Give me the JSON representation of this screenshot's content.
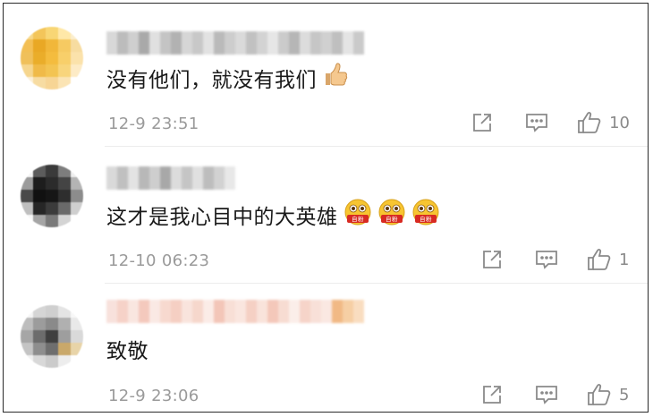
{
  "colors": {
    "text": "#1a1a1a",
    "meta": "#9a9a9a",
    "icon": "#8a8a8a",
    "divider": "#ececec",
    "border": "#2a2a2a"
  },
  "comments": [
    {
      "text": "没有他们，就没有我们",
      "emoji_icons": [
        "thumbs-up-icon"
      ],
      "time": "12-9 23:51",
      "like_count": "10",
      "avatar_colors": [
        "#f7d88a",
        "#f3c55a",
        "#f8d675",
        "#ffe8a8",
        "#fbeecd",
        "#f3bf54",
        "#e9a825",
        "#f1b73a",
        "#f6ca62",
        "#f7dca0",
        "#f0c05a",
        "#eaad2a",
        "#f4bc3e",
        "#f8cf6a",
        "#fbe2ab",
        "#f6d68e",
        "#f0ba48",
        "#f3c452",
        "#f8d57c",
        "#fdebc6",
        "#fcefd6",
        "#f7dca2",
        "#f7d595",
        "#fbe4b4",
        "#ffffff"
      ],
      "name_colors": [
        "#d8d8d8",
        "#bcbcbc",
        "#cfcfcf",
        "#a9a9a9",
        "#e0e0e0",
        "#c4c4c4",
        "#b2b2b2",
        "#d6d6d6",
        "#c8c8c8",
        "#e2e2e2",
        "#bababa",
        "#cdcdcd",
        "#dadada",
        "#c1c1c1",
        "#d3d3d3",
        "#e6e6e6",
        "#cbcbcb",
        "#b6b6b6",
        "#dcdcdc",
        "#c6c6c6",
        "#d0d0d0",
        "#bfbfbf",
        "#e4e4e4",
        "#cacaca"
      ]
    },
    {
      "text": "这才是我心目中的大英雄",
      "emoji_icons": [
        "idol-fan-emoji-icon",
        "idol-fan-emoji-icon",
        "idol-fan-emoji-icon"
      ],
      "emoji_badge": "自粉",
      "time": "12-10 06:23",
      "like_count": "1",
      "avatar_colors": [
        "#f4f4f4",
        "#5c5c5c",
        "#3a3a3a",
        "#7d7d7d",
        "#eeeeee",
        "#9b9b9b",
        "#1d1d1d",
        "#2b2b2b",
        "#444444",
        "#b4b4b4",
        "#4a4a4a",
        "#111111",
        "#161616",
        "#2e2e2e",
        "#8c8c8c",
        "#bfbfbf",
        "#262626",
        "#3b3b3b",
        "#6a6a6a",
        "#cfcfcf",
        "#f7f7f7",
        "#a5a5a5",
        "#7a7a7a",
        "#d4d4d4",
        "#ffffff"
      ],
      "name_colors": [
        "#d9d9d9",
        "#c0c0c0",
        "#e3e3e3",
        "#b8b8b8",
        "#cecece",
        "#a8a8a8",
        "#dcdcdc",
        "#c5c5c5",
        "#e0e0e0",
        "#bdbdbd",
        "#d2d2d2",
        "#e8e8e8"
      ]
    },
    {
      "text": "致敬",
      "emoji_icons": [],
      "time": "12-9 23:06",
      "like_count": "5",
      "avatar_colors": [
        "#f5f5f5",
        "#d5d5d5",
        "#cfcfcf",
        "#e4e4e4",
        "#f8f8f8",
        "#bdbdbd",
        "#9c9c9c",
        "#8a8a8a",
        "#b0b0b0",
        "#e9e9e9",
        "#a6a6a6",
        "#6c6c6c",
        "#3f3f3f",
        "#9e9e9e",
        "#d9d9d9",
        "#c4c4c4",
        "#8e8e8e",
        "#6e6e6e",
        "#c9a86a",
        "#e8d4a8",
        "#f1f1f1",
        "#d8d8d8",
        "#cbcbcb",
        "#ededed",
        "#ffffff"
      ],
      "name_colors": [
        "#f8e1dc",
        "#f6d2c8",
        "#f9e6e0",
        "#f4c9bd",
        "#fae9e4",
        "#f7d9cf",
        "#f5cfc3",
        "#f9e4dd",
        "#f6d7cc",
        "#fbece7",
        "#f3c6b8",
        "#f8dfd6",
        "#fae6df",
        "#f5d0c4",
        "#f9e3db",
        "#f4c8ba",
        "#f7dcd2",
        "#fbeee9",
        "#f6d4c9",
        "#f8e0d8",
        "#fae8e2",
        "#f1b985",
        "#f6cfa4",
        "#f9ddc0"
      ]
    }
  ]
}
